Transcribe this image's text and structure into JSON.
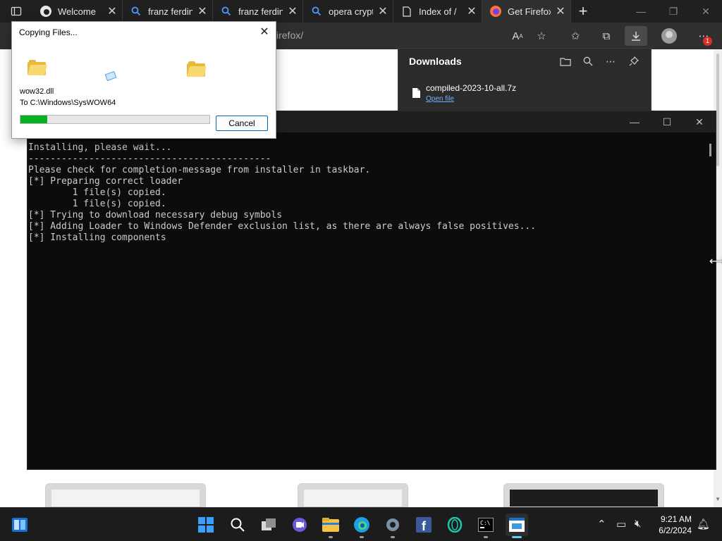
{
  "browser": {
    "tabs": [
      {
        "title": "Welcome",
        "icon": "edge-icon",
        "active": false
      },
      {
        "title": "franz ferdin",
        "icon": "search-icon",
        "active": false
      },
      {
        "title": "franz ferdin",
        "icon": "search-icon",
        "active": false
      },
      {
        "title": "opera crypt",
        "icon": "search-icon",
        "active": false
      },
      {
        "title": "Index of /",
        "icon": "page-icon",
        "active": false
      },
      {
        "title": "Get Firefox",
        "icon": "firefox-icon",
        "active": true
      }
    ],
    "address_fragment": "irefox/",
    "notification_count": "1"
  },
  "downloads": {
    "title": "Downloads",
    "item_name": "compiled-2023-10-all.7z",
    "item_action": "Open file"
  },
  "copy_dialog": {
    "title": "Copying Files...",
    "file": "wow32.dll",
    "destination": "To C:\\Windows\\SysWOW64",
    "progress_fraction": 0.14,
    "cancel_label": "Cancel"
  },
  "console": {
    "lines": [
      "Installing, please wait...",
      "--------------------------------------------",
      "Please check for completion-message from installer in taskbar.",
      "[*] Preparing correct loader",
      "        1 file(s) copied.",
      "        1 file(s) copied.",
      "[*] Trying to download necessary debug symbols",
      "[*] Adding Loader to Windows Defender exclusion list, as there are always false positives...",
      "[*] Installing components"
    ]
  },
  "taskbar": {
    "time": "9:21 AM",
    "date": "6/2/2024"
  },
  "colors": {
    "progress_fill": "#06b025",
    "accent": "#0067c0",
    "console_bg": "#0c0c0c"
  }
}
